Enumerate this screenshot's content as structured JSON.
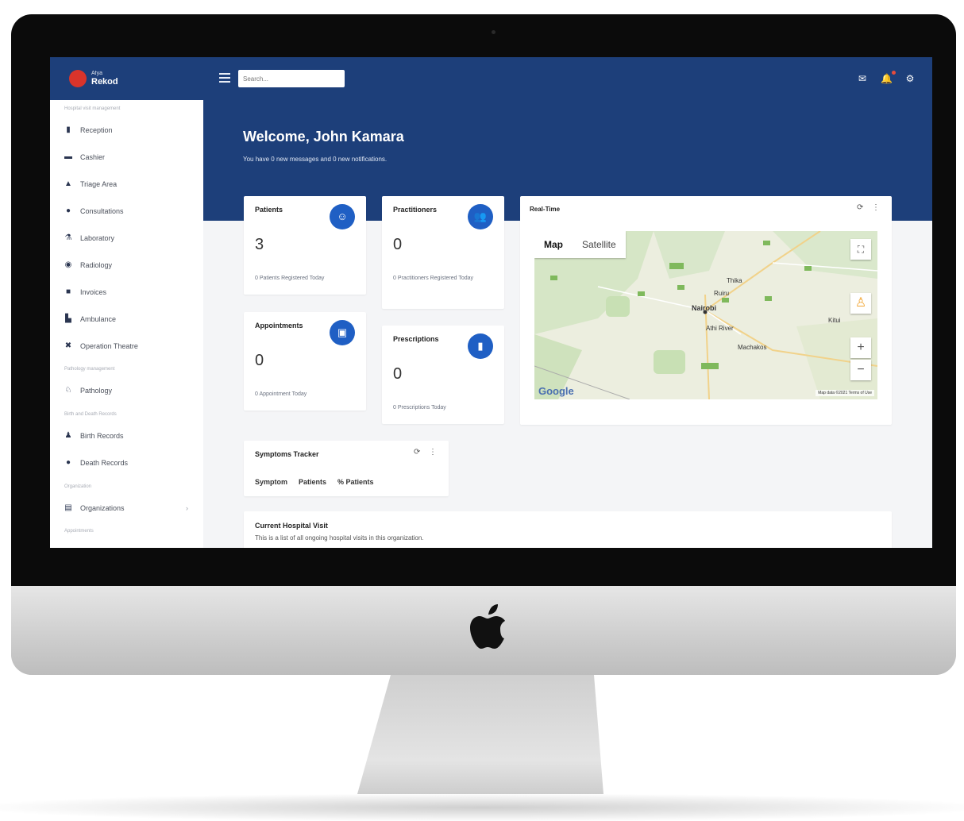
{
  "app": {
    "brand_small": "Afya",
    "brand_name": "Rekod"
  },
  "topbar": {
    "search_placeholder": "Search..."
  },
  "sidebar": {
    "section_hospital": "Hospital visit management",
    "section_pathology": "Pathology management",
    "section_birth_death": "Birth and Death Records",
    "section_organization": "Organization",
    "section_appointments": "Appointments",
    "items": [
      {
        "label": "Reception",
        "icon": "reception-icon"
      },
      {
        "label": "Cashier",
        "icon": "cashier-icon"
      },
      {
        "label": "Triage Area",
        "icon": "triage-icon"
      },
      {
        "label": "Consultations",
        "icon": "consultation-icon"
      },
      {
        "label": "Laboratory",
        "icon": "laboratory-icon"
      },
      {
        "label": "Radiology",
        "icon": "radiology-icon"
      },
      {
        "label": "Invoices",
        "icon": "invoice-icon"
      },
      {
        "label": "Ambulance",
        "icon": "ambulance-icon"
      },
      {
        "label": "Operation Theatre",
        "icon": "operation-icon"
      },
      {
        "label": "Pathology",
        "icon": "pathology-icon"
      },
      {
        "label": "Birth Records",
        "icon": "birth-icon"
      },
      {
        "label": "Death Records",
        "icon": "death-icon"
      },
      {
        "label": "Organizations",
        "icon": "organization-icon"
      }
    ]
  },
  "hero": {
    "welcome": "Welcome, John Kamara",
    "subtitle": "You have 0 new messages and 0 new notifications."
  },
  "cards": {
    "patients": {
      "title": "Patients",
      "value": "3",
      "foot": "0 Patients Registered Today"
    },
    "practitioners": {
      "title": "Practitioners",
      "value": "0",
      "foot": "0 Practitioners Registered Today"
    },
    "appointments": {
      "title": "Appointments",
      "value": "0",
      "foot": "0 Appointment Today"
    },
    "prescriptions": {
      "title": "Prescriptions",
      "value": "0",
      "foot": "0 Prescriptions Today"
    }
  },
  "realtime": {
    "title": "Real-Time",
    "map_tab": "Map",
    "satellite_tab": "Satellite",
    "city": "Nairobi",
    "places": [
      "Ruiru",
      "Thika",
      "Athi River",
      "Machakos",
      "Kitui"
    ],
    "google": "Google",
    "footer": "Map data ©2021  Terms of Use"
  },
  "tracker": {
    "title": "Symptoms Tracker",
    "columns": [
      "Symptom",
      "Patients",
      "% Patients"
    ]
  },
  "visits": {
    "title": "Current Hospital Visit",
    "subtitle": "This is a list of all ongoing hospital visits in this organization."
  },
  "colors": {
    "primary": "#1d3f7a",
    "accent": "#1f5fc4",
    "brand_red": "#d9342b"
  }
}
